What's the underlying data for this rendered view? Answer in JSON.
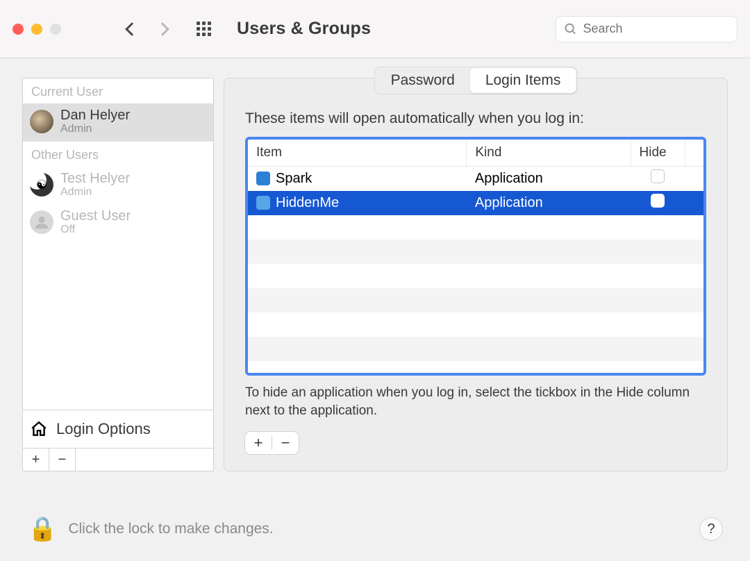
{
  "window": {
    "title": "Users & Groups",
    "search_placeholder": "Search"
  },
  "sidebar": {
    "current_label": "Current User",
    "current_user": {
      "name": "Dan Helyer",
      "role": "Admin"
    },
    "other_label": "Other Users",
    "other_users": [
      {
        "name": "Test Helyer",
        "role": "Admin"
      },
      {
        "name": "Guest User",
        "role": "Off"
      }
    ],
    "login_options": "Login Options"
  },
  "tabs": {
    "password": "Password",
    "login_items": "Login Items"
  },
  "main": {
    "intro": "These items will open automatically when you log in:",
    "columns": {
      "item": "Item",
      "kind": "Kind",
      "hide": "Hide"
    },
    "rows": [
      {
        "name": "Spark",
        "kind": "Application",
        "hide": false,
        "selected": false,
        "icon_color": "#2b7fd6"
      },
      {
        "name": "HiddenMe",
        "kind": "Application",
        "hide": false,
        "selected": true,
        "icon_color": "#57a6e6"
      }
    ],
    "hint": "To hide an application when you log in, select the tickbox in the Hide column next to the application."
  },
  "footer": {
    "lock_text": "Click the lock to make changes."
  }
}
